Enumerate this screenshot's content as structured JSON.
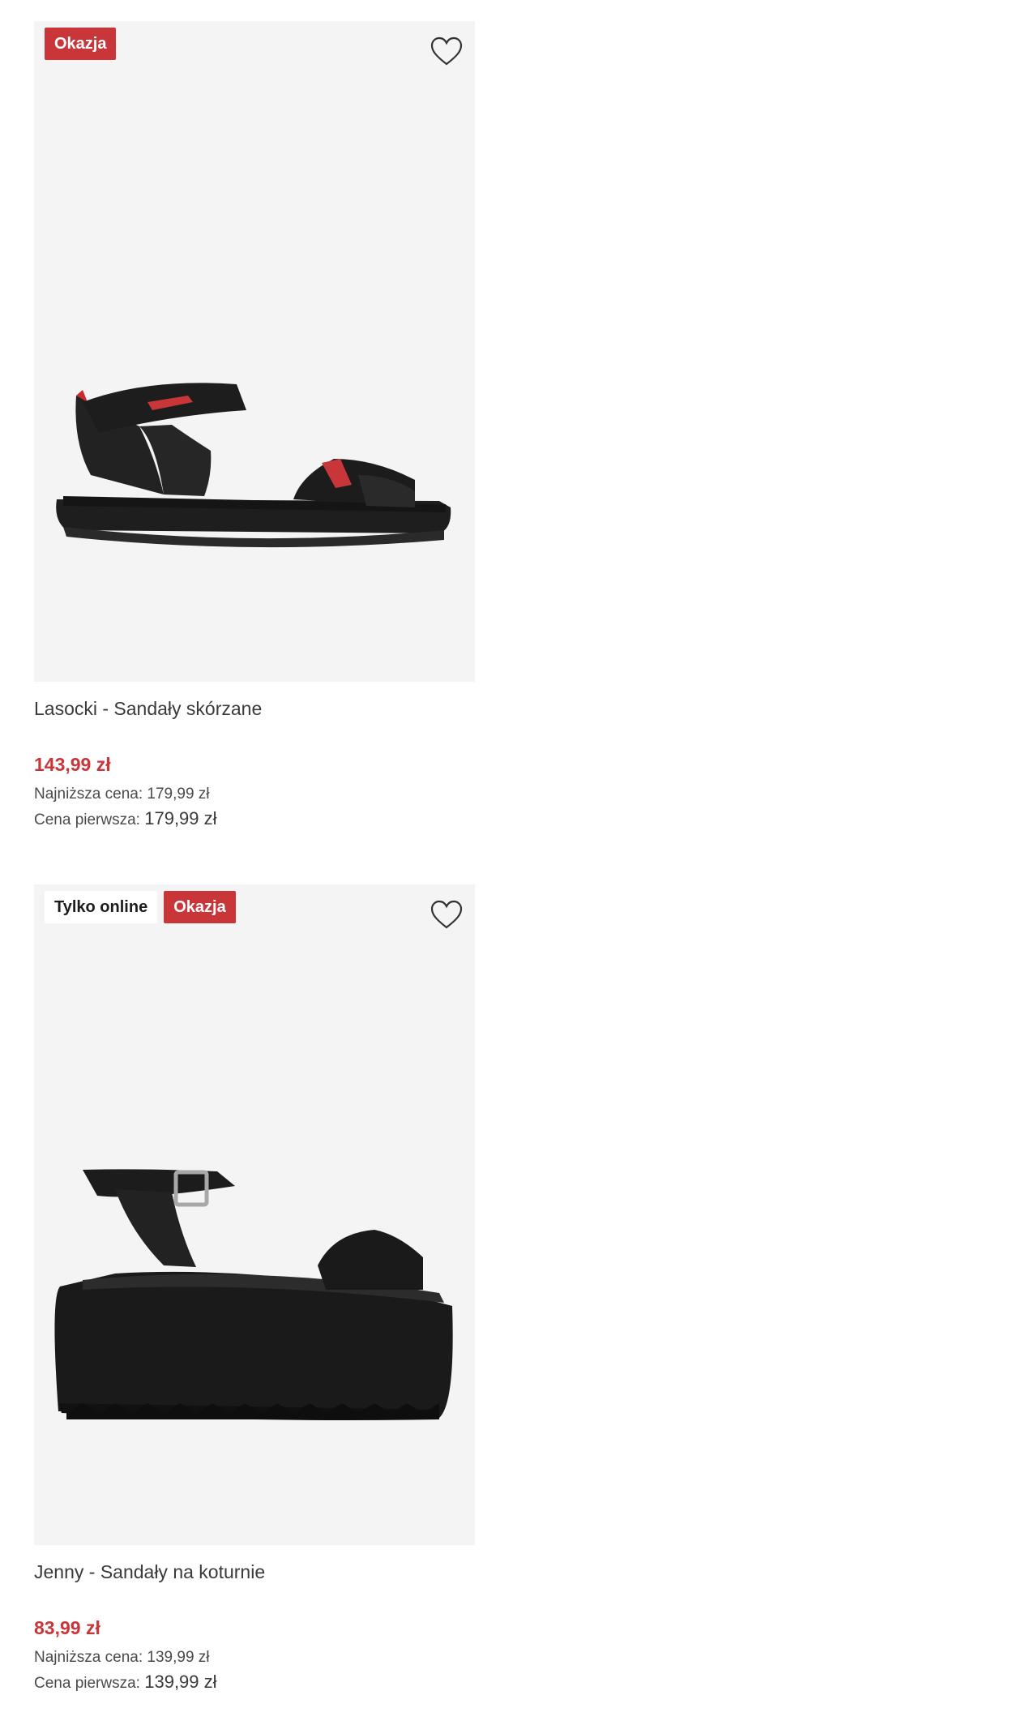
{
  "products": [
    {
      "badges": [
        "Okazja"
      ],
      "name": "Lasocki - Sandały skórzane",
      "price": "143,99 zł",
      "lowest_label": "Najniższa cena:",
      "lowest_value": "179,99 zł",
      "original_label": "Cena pierwsza:",
      "original_value": "179,99 zł",
      "icon": "heart-outline-icon"
    },
    {
      "badges": [
        "Tylko online",
        "Okazja"
      ],
      "name": "Jenny - Sandały na koturnie",
      "price": "83,99 zł",
      "lowest_label": "Najniższa cena:",
      "lowest_value": "139,99 zł",
      "original_label": "Cena pierwsza:",
      "original_value": "139,99 zł",
      "icon": "heart-outline-icon"
    }
  ],
  "colors": {
    "sale": "#c8363a",
    "image_bg": "#f4f4f4",
    "text": "#3a3a3a"
  }
}
